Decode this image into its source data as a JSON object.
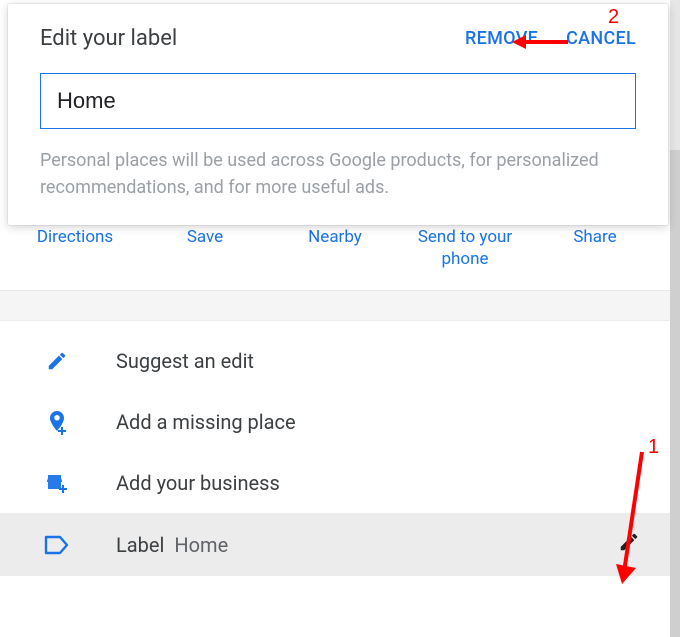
{
  "dialog": {
    "title": "Edit your label",
    "remove": "REMOVE",
    "cancel": "CANCEL",
    "input_value": "Home",
    "note": "Personal places will be used across Google products, for personalized recommendations, and for more useful ads."
  },
  "chips": {
    "directions": "Directions",
    "save": "Save",
    "nearby": "Nearby",
    "send": "Send to your phone",
    "share": "Share"
  },
  "list": {
    "suggest": "Suggest an edit",
    "add_place": "Add a missing place",
    "add_business": "Add your business",
    "label": "Label",
    "label_value": "Home"
  },
  "annotations": {
    "n1": "1",
    "n2": "2"
  }
}
